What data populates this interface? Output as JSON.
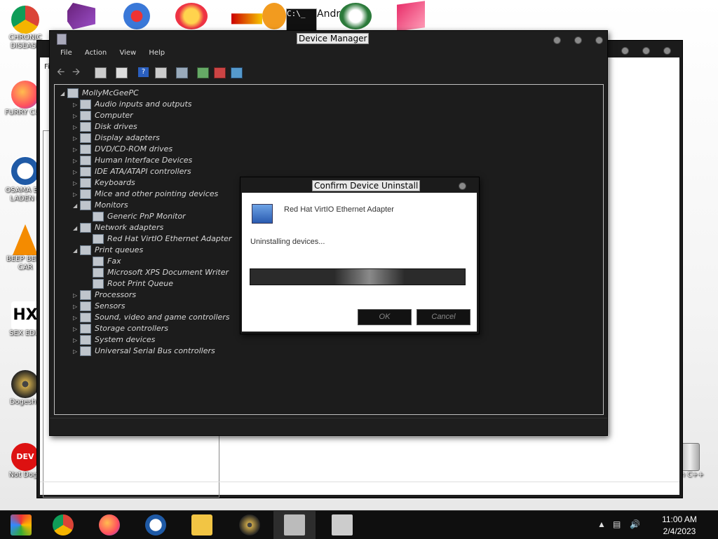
{
  "desktop": {
    "icons": [
      {
        "label": "CHRONIC DISEASE"
      },
      {
        "label": "FURRY CUM"
      },
      {
        "label": "OSAMA BIN LADEN E"
      },
      {
        "label": "BEEP BEEP CAR"
      },
      {
        "label": "SEX EDIT"
      },
      {
        "label": "Dogeshit"
      },
      {
        "label": "Not Doge"
      }
    ],
    "top_icon_text": "Andr   hou",
    "recycle_label": "an C++"
  },
  "device_manager": {
    "title": "Device Manager",
    "menu": [
      "File",
      "Action",
      "View",
      "Help"
    ],
    "tree": {
      "root": "MollyMcGeePC",
      "nodes": [
        {
          "label": "Audio inputs and outputs",
          "level": 1,
          "expanded": false
        },
        {
          "label": "Computer",
          "level": 1,
          "expanded": false
        },
        {
          "label": "Disk drives",
          "level": 1,
          "expanded": false
        },
        {
          "label": "Display adapters",
          "level": 1,
          "expanded": false
        },
        {
          "label": "DVD/CD-ROM drives",
          "level": 1,
          "expanded": false
        },
        {
          "label": "Human Interface Devices",
          "level": 1,
          "expanded": false
        },
        {
          "label": "IDE ATA/ATAPI controllers",
          "level": 1,
          "expanded": false
        },
        {
          "label": "Keyboards",
          "level": 1,
          "expanded": false
        },
        {
          "label": "Mice and other pointing devices",
          "level": 1,
          "expanded": false
        },
        {
          "label": "Monitors",
          "level": 1,
          "expanded": true
        },
        {
          "label": "Generic PnP Monitor",
          "level": 2
        },
        {
          "label": "Network adapters",
          "level": 1,
          "expanded": true
        },
        {
          "label": "Red Hat VirtIO Ethernet Adapter",
          "level": 2
        },
        {
          "label": "Print queues",
          "level": 1,
          "expanded": true
        },
        {
          "label": "Fax",
          "level": 2
        },
        {
          "label": "Microsoft XPS Document Writer",
          "level": 2
        },
        {
          "label": "Root Print Queue",
          "level": 2
        },
        {
          "label": "Processors",
          "level": 1,
          "expanded": false
        },
        {
          "label": "Sensors",
          "level": 1,
          "expanded": false
        },
        {
          "label": "Sound, video and game controllers",
          "level": 1,
          "expanded": false
        },
        {
          "label": "Storage controllers",
          "level": 1,
          "expanded": false
        },
        {
          "label": "System devices",
          "level": 1,
          "expanded": false
        },
        {
          "label": "Universal Serial Bus controllers",
          "level": 1,
          "expanded": false
        }
      ]
    }
  },
  "dialog": {
    "title": "Confirm Device Uninstall",
    "device_name": "Red Hat VirtIO Ethernet Adapter",
    "status": "Uninstalling devices...",
    "ok_label": "OK",
    "cancel_label": "Cancel"
  },
  "back_window": {
    "menu_partial": "Fi"
  },
  "taskbar": {
    "time": "11:00 AM",
    "date": "2/4/2023"
  },
  "colors": {
    "window_frame": "#1e1e1e",
    "tree_bg": "#1c1c1c",
    "taskbar": "#0f0f0f"
  }
}
